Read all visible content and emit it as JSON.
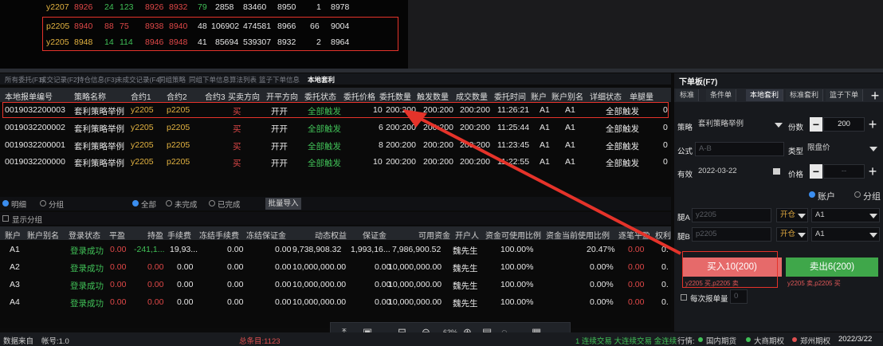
{
  "quote_rows": [
    {
      "c0": "y2207",
      "c1": "8926",
      "c2": "24",
      "c3": "123",
      "c4": "8926",
      "c5": "8932",
      "c6": "79",
      "c7": "2858",
      "c8": "83460",
      "c9": "8950",
      "c10": "1",
      "c11": "8978"
    },
    {
      "c0": "p2205",
      "c1": "8940",
      "c2": "88",
      "c3": "75",
      "c4": "8938",
      "c5": "8940",
      "c6": "48",
      "c7": "106902",
      "c8": "474581",
      "c9": "8966",
      "c10": "66",
      "c11": "9004"
    },
    {
      "c0": "y2205",
      "c1": "8948",
      "c2": "14",
      "c3": "114",
      "c4": "8946",
      "c5": "8948",
      "c6": "41",
      "c7": "85694",
      "c8": "539307",
      "c9": "8932",
      "c10": "2",
      "c11": "8964"
    }
  ],
  "order_tabs": [
    "所有委托(F1)",
    "成交记录(F2)",
    "持仓信息(F3)",
    "未成交记录(F4)",
    "同组策略",
    "同组下单信息",
    "算法列表",
    "篮子下单信息",
    "本地套利"
  ],
  "order_headers": [
    "本地报单编号",
    "策略名称",
    "合约1",
    "合约2",
    "合约3",
    "买卖方向",
    "开平方向",
    "委托状态",
    "委托价格",
    "委托数量",
    "触发数量",
    "成交数量",
    "委托时间",
    "账户",
    "账户别名",
    "详细状态",
    "单腿量"
  ],
  "orders": [
    {
      "id": "0019032200003",
      "strategy": "套利策略举例",
      "c1": "y2205",
      "c2": "p2205",
      "dir": "买",
      "oc": "开开",
      "status": "全部触发",
      "price": "10",
      "qty": "200:200",
      "trig": "200:200",
      "fill": "200:200",
      "time": "11:26:21",
      "acct": "A1",
      "alias": "A1",
      "detail": "全部触发",
      "leg": "0"
    },
    {
      "id": "0019032200002",
      "strategy": "套利策略举例",
      "c1": "y2205",
      "c2": "p2205",
      "dir": "买",
      "oc": "开开",
      "status": "全部触发",
      "price": "6",
      "qty": "200:200",
      "trig": "200:200",
      "fill": "200:200",
      "time": "11:25:44",
      "acct": "A1",
      "alias": "A1",
      "detail": "全部触发",
      "leg": "0"
    },
    {
      "id": "0019032200001",
      "strategy": "套利策略举例",
      "c1": "y2205",
      "c2": "p2205",
      "dir": "买",
      "oc": "开开",
      "status": "全部触发",
      "price": "8",
      "qty": "200:200",
      "trig": "200:200",
      "fill": "200:200",
      "time": "11:23:45",
      "acct": "A1",
      "alias": "A1",
      "detail": "全部触发",
      "leg": "0"
    },
    {
      "id": "0019032200000",
      "strategy": "套利策略举例",
      "c1": "y2205",
      "c2": "p2205",
      "dir": "买",
      "oc": "开开",
      "status": "全部触发",
      "price": "10",
      "qty": "200:200",
      "trig": "200:200",
      "fill": "200:200",
      "time": "11:22:55",
      "acct": "A1",
      "alias": "A1",
      "detail": "全部触发",
      "leg": "0"
    }
  ],
  "filter": {
    "detail": "明细",
    "group": "分组",
    "all": "全部",
    "uncompleted": "未完成",
    "completed": "已完成",
    "import": "批量导入",
    "show_group": "显示分组"
  },
  "acct_headers": [
    "账户",
    "账户别名",
    "登录状态",
    "平盈",
    "持盈",
    "手续费",
    "冻结手续费",
    "冻结保证金",
    "动态权益",
    "保证金",
    "可用资金",
    "开户人",
    "资金可使用比例",
    "资金当前使用比例",
    "逐笔平盈",
    "权利"
  ],
  "accounts": [
    {
      "acct": "A1",
      "login": "登录成功",
      "pnl": "0.00",
      "hold": "-241,1...",
      "fee": "19,93...",
      "frozenfee": "0.00",
      "frozenmargin": "0.00",
      "equity": "9,738,908.32",
      "margin": "1,993,16...",
      "avail": "7,986,900.52",
      "owner": "魏先生",
      "ratio": "100.00%",
      "cur": "20.47%",
      "each": "0.00",
      "right": "0."
    },
    {
      "acct": "A2",
      "login": "登录成功",
      "pnl": "0.00",
      "hold": "0.00",
      "fee": "0.00",
      "frozenfee": "0.00",
      "frozenmargin": "0.00",
      "equity": "10,000,000.00",
      "margin": "0.00",
      "avail": "10,000,000.00",
      "owner": "魏先生",
      "ratio": "100.00%",
      "cur": "0.00%",
      "each": "0.00",
      "right": "0."
    },
    {
      "acct": "A3",
      "login": "登录成功",
      "pnl": "0.00",
      "hold": "0.00",
      "fee": "0.00",
      "frozenfee": "0.00",
      "frozenmargin": "0.00",
      "equity": "10,000,000.00",
      "margin": "0.00",
      "avail": "10,000,000.00",
      "owner": "魏先生",
      "ratio": "100.00%",
      "cur": "0.00%",
      "each": "0.00",
      "right": "0."
    },
    {
      "acct": "A4",
      "login": "登录成功",
      "pnl": "0.00",
      "hold": "0.00",
      "fee": "0.00",
      "frozenfee": "0.00",
      "frozenmargin": "0.00",
      "equity": "10,000,000.00",
      "margin": "0.00",
      "avail": "10,000,000.00",
      "owner": "魏先生",
      "ratio": "100.00%",
      "cur": "0.00%",
      "each": "0.00",
      "right": "0."
    }
  ],
  "panel": {
    "title": "下单板(F7)",
    "tabs": [
      "标准",
      "条件单",
      "本地套利",
      "标准套利",
      "篮子下单"
    ],
    "plus": "+",
    "strategy_label": "策略",
    "strategy_value": "套利策略举例",
    "shares_label": "份数",
    "shares_value": "200",
    "formula_label": "公式",
    "formula_value": "A-B",
    "type_label": "类型",
    "type_value": "限盘价",
    "valid_label": "有效",
    "valid_value": "2022-03-22",
    "price_label": "价格",
    "price_value": "--",
    "acct_radio": "账户",
    "group_radio": "分组",
    "legA_label": "腿A",
    "legA_value": "y2205",
    "legA_oc": "开仓",
    "legA_acct": "A1",
    "legB_label": "腿B",
    "legB_value": "p2205",
    "legB_oc": "开仓",
    "legB_acct": "A1",
    "buy": "买入10(200)",
    "sell": "卖出6(200)",
    "buy_sub": "y2205 买,p2205 卖",
    "sell_sub": "y2205 卖,p2205 买",
    "each_order": "每次报单量",
    "each_order_value": "0"
  },
  "status": {
    "left1": "数据来自",
    "left2": "帐号:1.0",
    "mid": "总条目:1123",
    "zoom": "63%",
    "right_text": "1 连续交易 大连续交易 金连续",
    "r1": "行情:",
    "r2": "国内期货",
    "r3": "大商期权",
    "r4": "郑州期权",
    "date": "2022/3/22"
  }
}
